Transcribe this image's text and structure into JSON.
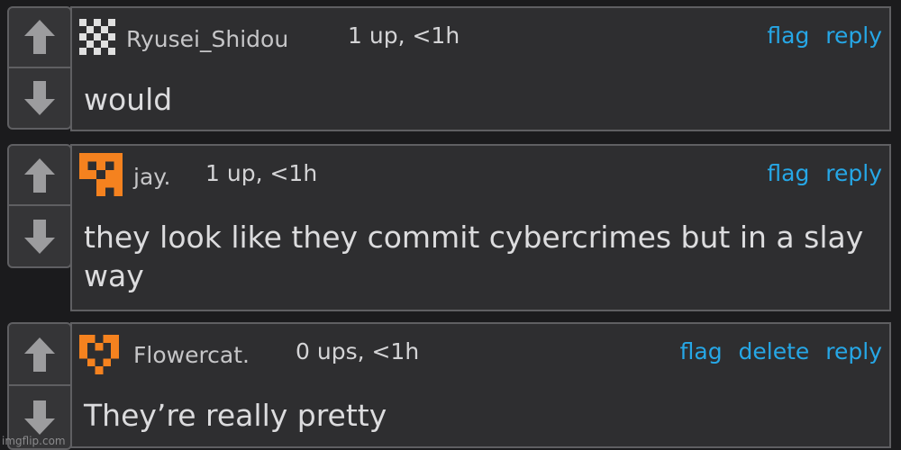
{
  "comments": [
    {
      "username": "Ryusei_Shidou",
      "meta": "1 up, <1h",
      "actions": [
        "flag",
        "reply"
      ],
      "text_lines": [
        "would"
      ],
      "avatar": "checkerboard-avatar-icon"
    },
    {
      "username": "jay.",
      "meta": "1 up, <1h",
      "actions": [
        "flag",
        "reply"
      ],
      "text_lines": [
        "they look like they commit cybercrimes but in a slay",
        "way"
      ],
      "avatar": "orange-pixel-avatar-icon"
    },
    {
      "username": "Flowercat.",
      "meta": "0 ups, <1h",
      "actions": [
        "flag",
        "delete",
        "reply"
      ],
      "text_lines": [
        "They’re really pretty"
      ],
      "avatar": "orange-heart-avatar-icon"
    }
  ],
  "watermark": "imgflip.com",
  "colors": {
    "background": "#1b1b1d",
    "panel": "#2e2e30",
    "border": "#5f5f62",
    "link": "#26a7e6",
    "avatar_orange": "#f5821f"
  }
}
